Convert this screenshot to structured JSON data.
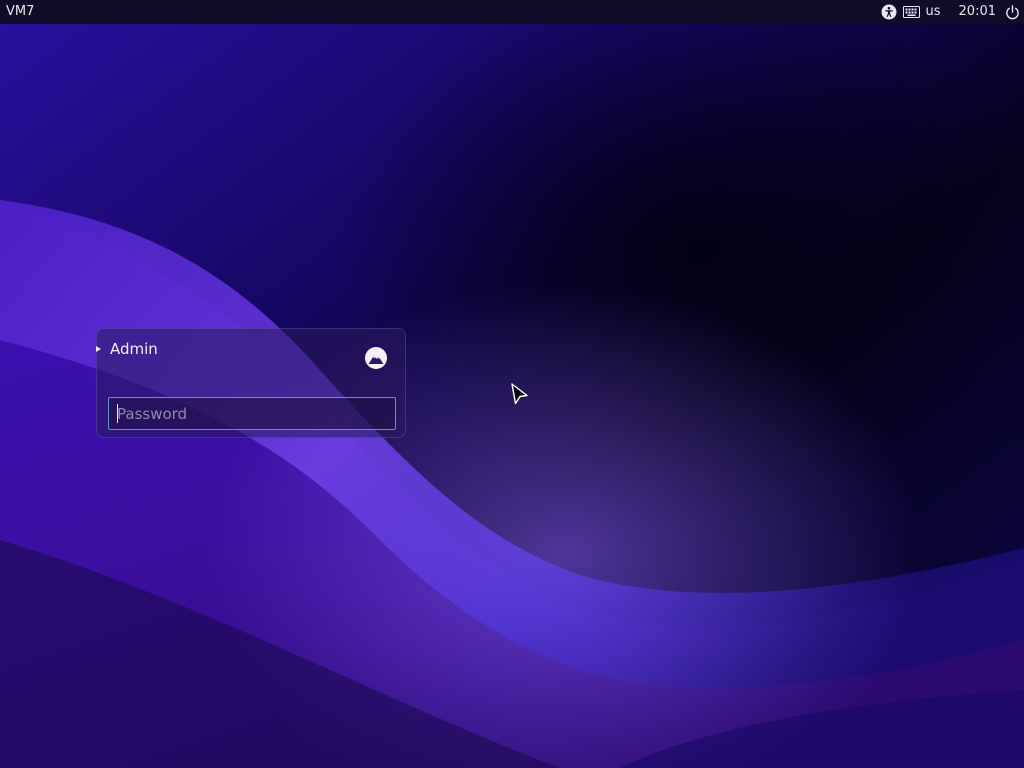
{
  "top_panel": {
    "host_name": "VM7",
    "keyboard_layout": "us",
    "clock": "20:01",
    "icons": [
      "accessibility-icon",
      "keyboard-icon",
      "power-icon"
    ]
  },
  "login": {
    "user_name": "Admin",
    "password": {
      "placeholder": "Password",
      "value": ""
    },
    "session_icon": "session-icon"
  },
  "colors": {
    "panel_bg": "#120b28",
    "wallpaper_base": "#0a0430",
    "wave_violet": "#7a4fe0",
    "field_border": "#5e92c8"
  }
}
